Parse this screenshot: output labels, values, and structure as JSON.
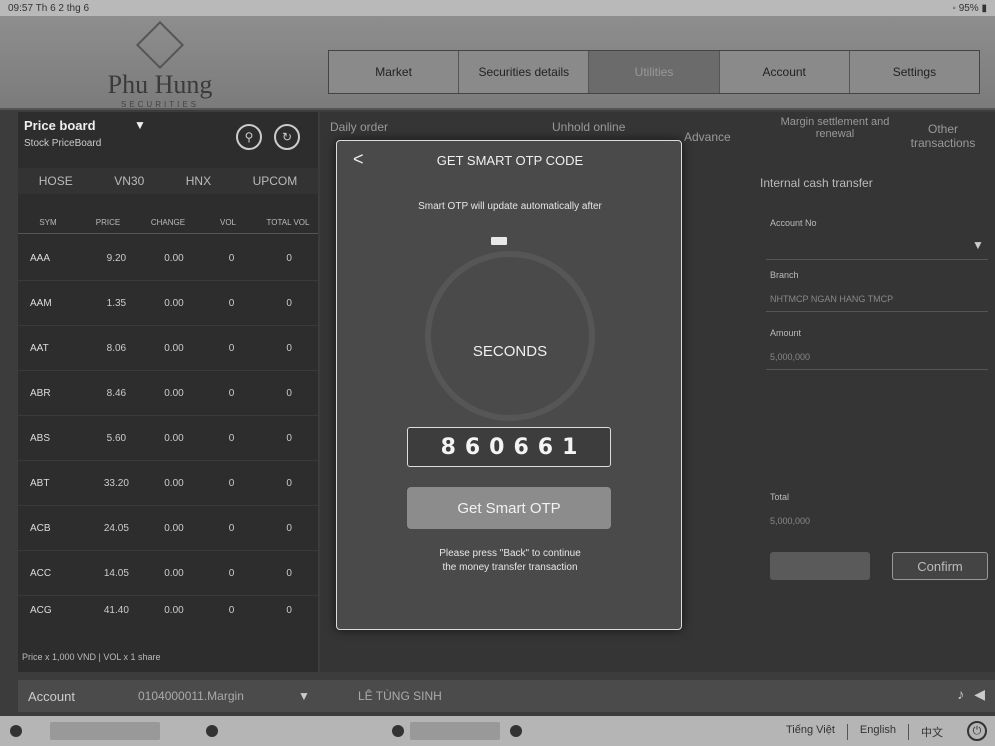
{
  "statusbar": {
    "time": "09:57",
    "date": "Th 6 2 thg 6",
    "battery": "95%"
  },
  "logo": {
    "name": "Phu Hung",
    "tagline": "SECURITIES"
  },
  "nav": {
    "tabs": [
      "Market",
      "Securities details",
      "Utilities",
      "Account",
      "Settings"
    ],
    "active_index": 2
  },
  "priceboard": {
    "title": "Price board",
    "subtitle": "Stock PriceBoard",
    "markets": [
      "HOSE",
      "VN30",
      "HNX",
      "UPCOM"
    ],
    "columns": [
      "SYM",
      "PRICE",
      "CHANGE",
      "VOL",
      "TOTAL VOL"
    ],
    "rows": [
      {
        "sym": "AAA",
        "price": "9.20",
        "change": "0.00",
        "vol": "0",
        "total": "0"
      },
      {
        "sym": "AAM",
        "price": "1.35",
        "change": "0.00",
        "vol": "0",
        "total": "0"
      },
      {
        "sym": "AAT",
        "price": "8.06",
        "change": "0.00",
        "vol": "0",
        "total": "0"
      },
      {
        "sym": "ABR",
        "price": "8.46",
        "change": "0.00",
        "vol": "0",
        "total": "0"
      },
      {
        "sym": "ABS",
        "price": "5.60",
        "change": "0.00",
        "vol": "0",
        "total": "0"
      },
      {
        "sym": "ABT",
        "price": "33.20",
        "change": "0.00",
        "vol": "0",
        "total": "0"
      },
      {
        "sym": "ACB",
        "price": "24.05",
        "change": "0.00",
        "vol": "0",
        "total": "0"
      },
      {
        "sym": "ACC",
        "price": "14.05",
        "change": "0.00",
        "vol": "0",
        "total": "0"
      },
      {
        "sym": "ACG",
        "price": "41.40",
        "change": "0.00",
        "vol": "0",
        "total": "0"
      }
    ],
    "footnote": "Price x 1,000 VND | VOL x 1 share"
  },
  "utilities_menu": [
    "Daily order",
    "Unhold online",
    "Advance",
    "Margin settlement and renewal",
    "Other transactions"
  ],
  "transfer": {
    "title": "Internal cash transfer",
    "account_label": "Account No",
    "branch_label": "Branch",
    "branch_value": "NHTMCP NGAN HANG TMCP",
    "amount_label": "Amount",
    "amount_value": "5,000,000",
    "total_label": "Total",
    "total_value": "5,000,000",
    "confirm_label": "Confirm"
  },
  "modal": {
    "back": "<",
    "title": "GET SMART OTP CODE",
    "note": "Smart OTP will update automatically after",
    "timer_label": "SECONDS",
    "otp_code": "860661",
    "button_label": "Get Smart OTP",
    "hint_line1": "Please press \"Back\" to continue",
    "hint_line2": "the money transfer transaction"
  },
  "accountbar": {
    "label": "Account",
    "number": "0104000011.Margin",
    "name": "LÊ TÙNG SINH"
  },
  "footer": {
    "languages": [
      "Tiếng Việt",
      "English",
      "中文"
    ]
  }
}
